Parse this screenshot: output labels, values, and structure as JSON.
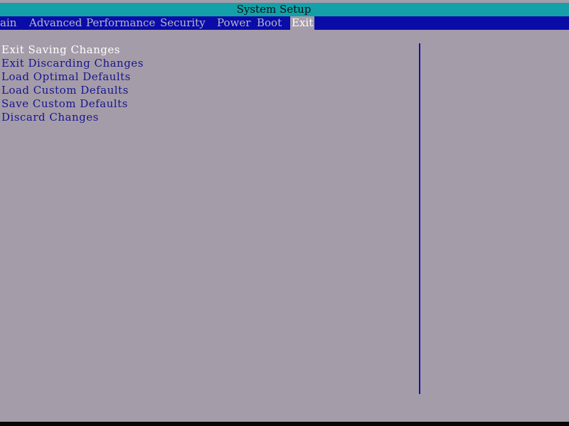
{
  "header": {
    "title": "System Setup"
  },
  "menu": {
    "tabs": [
      {
        "label": "ain",
        "active": false
      },
      {
        "label": "Advanced",
        "active": false
      },
      {
        "label": "Performance",
        "active": false
      },
      {
        "label": "Security",
        "active": false
      },
      {
        "label": "Power",
        "active": false
      },
      {
        "label": "Boot",
        "active": false
      },
      {
        "label": "Exit",
        "active": true
      }
    ]
  },
  "exit_menu": {
    "items": [
      {
        "label": "Exit Saving Changes",
        "selected": true
      },
      {
        "label": "Exit Discarding Changes",
        "selected": false
      },
      {
        "label": "Load Optimal Defaults",
        "selected": false
      },
      {
        "label": "Load Custom Defaults",
        "selected": false
      },
      {
        "label": "Save Custom Defaults",
        "selected": false
      },
      {
        "label": "Discard Changes",
        "selected": false
      }
    ]
  },
  "colors": {
    "title_bar": "#13a0a8",
    "menu_bar": "#0b0ca8",
    "background": "#a59ca9",
    "item_text": "#16168f",
    "highlight_text": "#ffffff"
  }
}
